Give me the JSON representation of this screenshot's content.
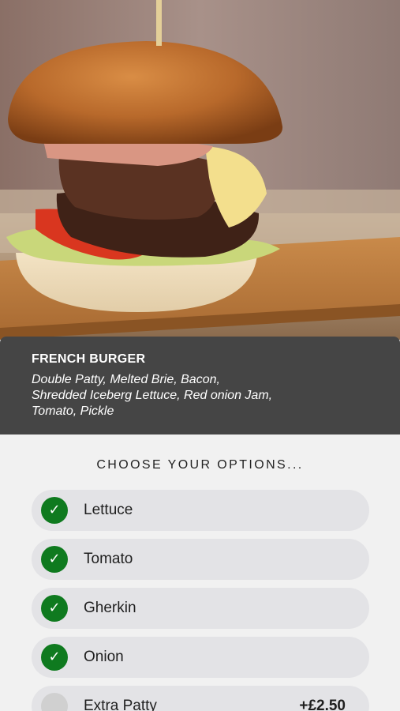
{
  "product": {
    "title": "FRENCH BURGER",
    "description": "Double Patty, Melted Brie, Bacon, Shredded Iceberg Lettuce, Red onion Jam, Tomato, Pickle"
  },
  "options": {
    "heading": "CHOOSE YOUR OPTIONS...",
    "items": [
      {
        "label": "Lettuce",
        "selected": true,
        "check_glyph": "✓",
        "price": ""
      },
      {
        "label": "Tomato",
        "selected": true,
        "check_glyph": "✓",
        "price": ""
      },
      {
        "label": "Gherkin",
        "selected": true,
        "check_glyph": "✓",
        "price": ""
      },
      {
        "label": "Onion",
        "selected": true,
        "check_glyph": "✓",
        "price": ""
      },
      {
        "label": "Extra Patty",
        "selected": false,
        "check_glyph": "",
        "price": "+£2.50"
      }
    ]
  },
  "colors": {
    "info_panel": "#454545",
    "check_selected": "#0f7a1f",
    "check_unselected": "#d0d0d0",
    "option_row": "#e3e3e6",
    "page_background": "#f1f1f1"
  }
}
